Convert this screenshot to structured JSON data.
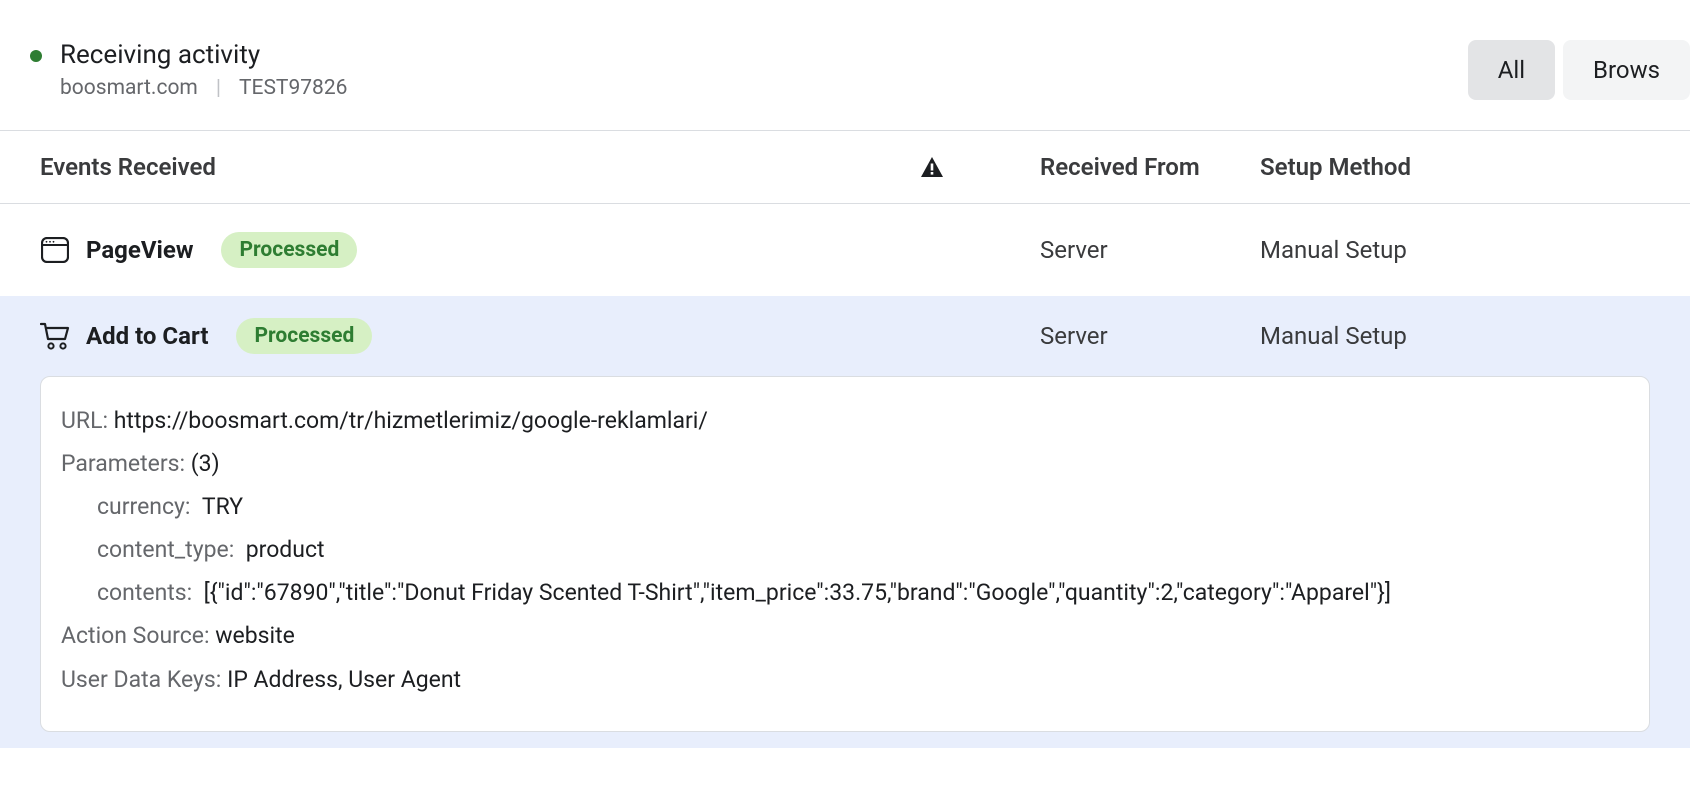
{
  "header": {
    "title": "Receiving activity",
    "domain": "boosmart.com",
    "separator": "|",
    "pixel_id": "TEST97826"
  },
  "tabs": {
    "all": "All",
    "browser": "Brows"
  },
  "columns": {
    "events_received": "Events Received",
    "received_from": "Received From",
    "setup_method": "Setup Method"
  },
  "rows": [
    {
      "icon": "browser",
      "name": "PageView",
      "status": "Processed",
      "received_from": "Server",
      "setup_method": "Manual Setup",
      "expanded": false
    },
    {
      "icon": "cart",
      "name": "Add to Cart",
      "status": "Processed",
      "received_from": "Server",
      "setup_method": "Manual Setup",
      "expanded": true,
      "details": {
        "labels": {
          "url": "URL:",
          "parameters": "Parameters:",
          "action_source": "Action Source:",
          "user_data_keys": "User Data Keys:"
        },
        "url": "https://boosmart.com/tr/hizmetlerimiz/google-reklamlari/",
        "param_count": "(3)",
        "params": [
          {
            "key": "currency:",
            "value": "TRY"
          },
          {
            "key": "content_type:",
            "value": "product"
          },
          {
            "key": "contents:",
            "value": "[{\"id\":\"67890\",\"title\":\"Donut Friday Scented T-Shirt\",\"item_price\":33.75,\"brand\":\"Google\",\"quantity\":2,\"category\":\"Apparel\"}]"
          }
        ],
        "action_source": "website",
        "user_data_keys": "IP Address, User Agent"
      }
    }
  ]
}
